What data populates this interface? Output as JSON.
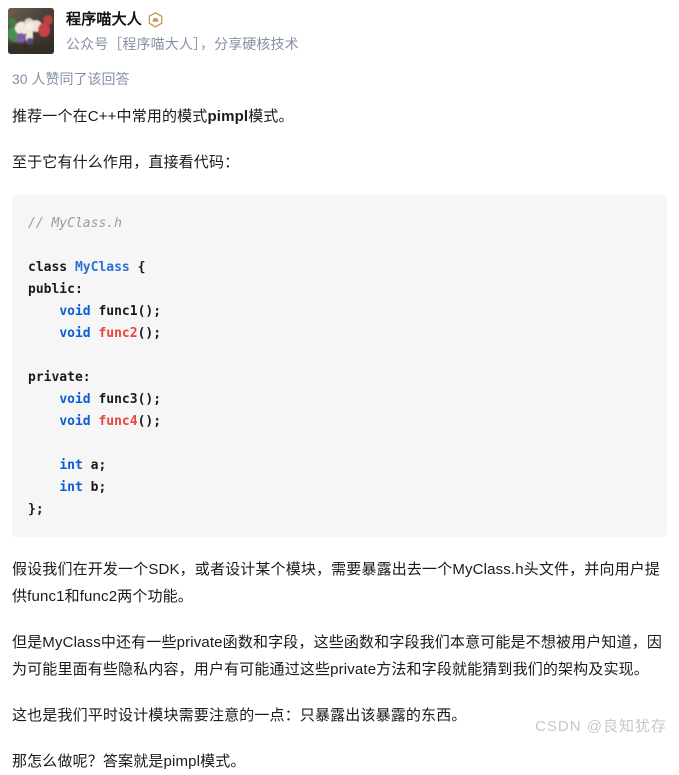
{
  "author": {
    "name": "程序喵大人",
    "badge_icon": "hexagon-badge-icon",
    "badge_color": "#c49a5a",
    "bio": "公众号［程序喵大人］，分享硬核技术",
    "avatar_alt": "avatar-photo"
  },
  "voters": {
    "text": "30 人赞同了该回答",
    "count": 30
  },
  "body": {
    "para1_prefix": "推荐一个在C++中常用的模式",
    "para1_bold": "pimpl",
    "para1_suffix": "模式。",
    "para2": "至于它有什么作用，直接看代码：",
    "para3": "假设我们在开发一个SDK，或者设计某个模块，需要暴露出去一个MyClass.h头文件，并向用户提供func1和func2两个功能。",
    "para4": "但是MyClass中还有一些private函数和字段，这些函数和字段我们本意可能是不想被用户知道，因为可能里面有些隐私内容，用户有可能通过这些private方法和字段就能猜到我们的架构及实现。",
    "para5": "这也是我们平时设计模块需要注意的一点：只暴露出该暴露的东西。",
    "para6": "那怎么做呢？答案就是pimpl模式。"
  },
  "code": {
    "language": "cpp",
    "background": "#f6f6f6",
    "tokens": {
      "comment": "// MyClass.h",
      "kw_class": "class",
      "name_myclass": "MyClass",
      "brace_open": " {",
      "label_public": "public:",
      "kw_void": "void",
      "fn_func1": "func1();",
      "fn_func2": "func2",
      "paren_semi": "();",
      "label_private": "private:",
      "fn_func3": "func3();",
      "fn_func4": "func4",
      "kw_int": "int",
      "var_a": "a;",
      "var_b": "b;",
      "close": "};"
    },
    "full_text": "// MyClass.h\n\nclass MyClass {\npublic:\n    void func1();\n    void func2();\n\nprivate:\n    void func3();\n    void func4();\n\n    int a;\n    int b;\n};"
  },
  "watermark": {
    "text": "CSDN @良知犹存"
  },
  "colors": {
    "keyword_blue": "#0b5cd5",
    "class_blue": "#2a6fd6",
    "function_red": "#e8453c",
    "comment_gray": "#9b9b9b",
    "meta_gray": "#8590a6",
    "text_dark": "#1a1a1a",
    "code_bg": "#f6f6f6",
    "watermark_gray": "#c8c8c8"
  }
}
